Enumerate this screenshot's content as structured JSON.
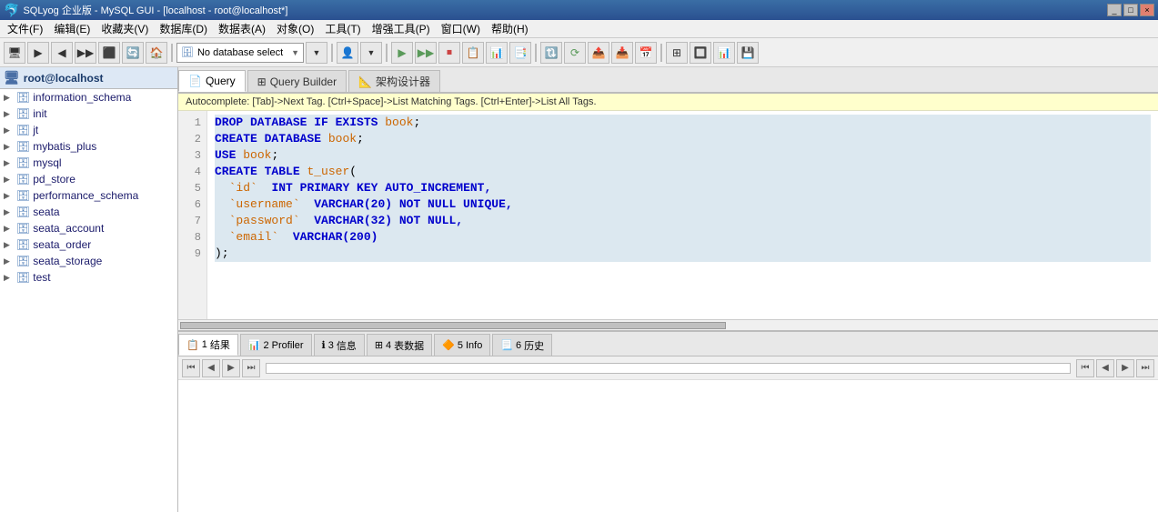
{
  "titleBar": {
    "title": "SQLyog 企业版 - MySQL GUI - [localhost - root@localhost*]",
    "buttons": [
      "_",
      "□",
      "×"
    ]
  },
  "menuBar": {
    "items": [
      "文件(F)",
      "编辑(E)",
      "收藏夹(V)",
      "数据库(D)",
      "数据表(A)",
      "对象(O)",
      "工具(T)",
      "增强工具(P)",
      "窗口(W)",
      "帮助(H)"
    ]
  },
  "toolbar": {
    "dbSelector": "No database select",
    "dbSelectorArrow": "▼"
  },
  "sidebar": {
    "root": {
      "label": "root@localhost",
      "icon": "🖥"
    },
    "items": [
      {
        "name": "information_schema",
        "expanded": false
      },
      {
        "name": "init",
        "expanded": false
      },
      {
        "name": "jt",
        "expanded": false
      },
      {
        "name": "mybatis_plus",
        "expanded": false
      },
      {
        "name": "mysql",
        "expanded": false
      },
      {
        "name": "pd_store",
        "expanded": false
      },
      {
        "name": "performance_schema",
        "expanded": false
      },
      {
        "name": "seata",
        "expanded": false
      },
      {
        "name": "seata_account",
        "expanded": false
      },
      {
        "name": "seata_order",
        "expanded": false
      },
      {
        "name": "seata_storage",
        "expanded": false
      },
      {
        "name": "test",
        "expanded": false
      }
    ]
  },
  "tabs": [
    {
      "label": "Query",
      "icon": "📄",
      "active": true
    },
    {
      "label": "Query Builder",
      "icon": "⊞",
      "active": false
    },
    {
      "label": "架构设计器",
      "icon": "📐",
      "active": false
    }
  ],
  "autocomplete": {
    "hint": "Autocomplete: [Tab]->Next Tag. [Ctrl+Space]->List Matching Tags. [Ctrl+Enter]->List All Tags."
  },
  "editor": {
    "lines": [
      {
        "num": "1",
        "text": "DROP DATABASE IF EXISTS book;",
        "tokens": [
          {
            "t": "DROP DATABASE IF EXISTS",
            "c": "kw"
          },
          {
            "t": " "
          },
          {
            "t": "book",
            "c": "id"
          },
          {
            "t": ";"
          }
        ]
      },
      {
        "num": "2",
        "text": "CREATE DATABASE book;",
        "tokens": [
          {
            "t": "CREATE DATABASE",
            "c": "kw"
          },
          {
            "t": " "
          },
          {
            "t": "book",
            "c": "id"
          },
          {
            "t": ";"
          }
        ]
      },
      {
        "num": "3",
        "text": "USE book;",
        "tokens": [
          {
            "t": "USE",
            "c": "kw"
          },
          {
            "t": " "
          },
          {
            "t": "book",
            "c": "id"
          },
          {
            "t": ";"
          }
        ]
      },
      {
        "num": "4",
        "text": "CREATE TABLE t_user(",
        "tokens": [
          {
            "t": "CREATE TABLE",
            "c": "kw"
          },
          {
            "t": " "
          },
          {
            "t": "t_user",
            "c": "id"
          },
          {
            "t": "("
          }
        ]
      },
      {
        "num": "5",
        "text": "  `id`  INT PRIMARY KEY AUTO_INCREMENT,",
        "tokens": [
          {
            "t": "  "
          },
          {
            "t": "`id`",
            "c": "id"
          },
          {
            "t": "  "
          },
          {
            "t": "INT PRIMARY KEY AUTO_INCREMENT,",
            "c": "kw"
          }
        ]
      },
      {
        "num": "6",
        "text": "  `username`  VARCHAR(20) NOT NULL UNIQUE,",
        "tokens": [
          {
            "t": "  "
          },
          {
            "t": "`username`",
            "c": "id"
          },
          {
            "t": "  "
          },
          {
            "t": "VARCHAR(20) NOT NULL UNIQUE,",
            "c": "kw"
          }
        ]
      },
      {
        "num": "7",
        "text": "  `password`  VARCHAR(32) NOT NULL,",
        "tokens": [
          {
            "t": "  "
          },
          {
            "t": "`password`",
            "c": "id"
          },
          {
            "t": "  "
          },
          {
            "t": "VARCHAR(32) NOT NULL,",
            "c": "kw"
          }
        ]
      },
      {
        "num": "8",
        "text": "  `email`  VARCHAR(200)",
        "tokens": [
          {
            "t": "  "
          },
          {
            "t": "`email`",
            "c": "id"
          },
          {
            "t": "  "
          },
          {
            "t": "VARCHAR(200)",
            "c": "kw"
          }
        ]
      },
      {
        "num": "9",
        "text": ");",
        "tokens": [
          {
            "t": ");"
          }
        ]
      }
    ]
  },
  "bottomTabs": [
    {
      "num": "1",
      "label": "结果",
      "icon": "📋",
      "active": true
    },
    {
      "num": "2",
      "label": "Profiler",
      "icon": "📊",
      "active": false
    },
    {
      "num": "3",
      "label": "信息",
      "icon": "ℹ",
      "active": false
    },
    {
      "num": "4",
      "label": "表数据",
      "icon": "⊞",
      "active": false
    },
    {
      "num": "5",
      "label": "Info",
      "icon": "🔶",
      "active": false
    },
    {
      "num": "6",
      "label": "历史",
      "icon": "📃",
      "active": false
    }
  ],
  "bottomToolbar": {
    "buttons": [
      "⟨⟨",
      "⟨",
      "⟩",
      "⟩⟩",
      "|",
      "⟨⟨",
      "⟨",
      "⟩",
      "⟩⟩"
    ]
  }
}
